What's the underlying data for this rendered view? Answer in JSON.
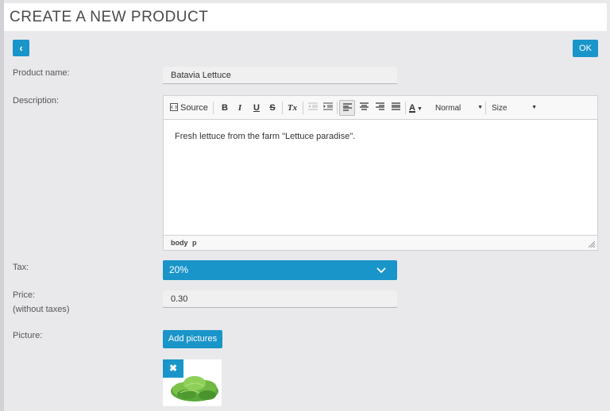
{
  "page": {
    "title": "CREATE A NEW PRODUCT"
  },
  "actions": {
    "back_label": "‹",
    "ok_label": "OK"
  },
  "form": {
    "product_name": {
      "label": "Product name:",
      "value": "Batavia Lettuce"
    },
    "description": {
      "label": "Description:",
      "content": "Fresh lettuce from the farm \"Lettuce paradise\".",
      "path": [
        "body",
        "p"
      ]
    },
    "tax": {
      "label": "Tax:",
      "value": "20%"
    },
    "price": {
      "label": "Price:",
      "sublabel": "(without taxes)",
      "value": "0.30"
    },
    "picture": {
      "label": "Picture:",
      "add_label": "Add pictures",
      "remove_label": "✖"
    }
  },
  "editor_toolbar": {
    "source_label": "Source",
    "bold": "B",
    "italic": "I",
    "underline": "U",
    "strike": "S",
    "clear_format": "Tx",
    "text_color": "A",
    "format_label": "Normal",
    "size_label": "Size"
  },
  "colors": {
    "accent": "#1a95c9",
    "background": "#e9e9ec"
  }
}
